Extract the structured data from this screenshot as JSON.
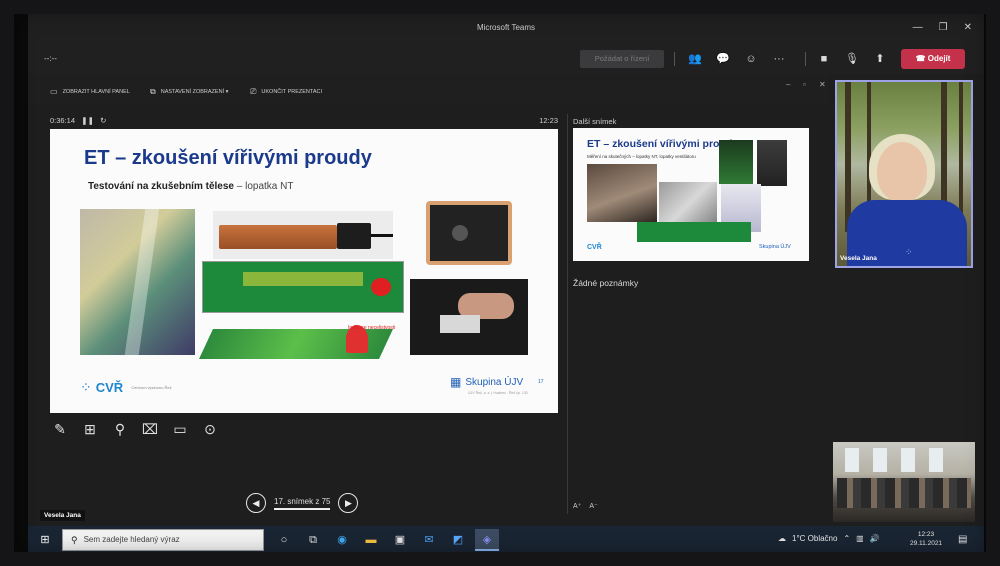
{
  "window": {
    "title": "Microsoft Teams",
    "controls": {
      "minimize": "—",
      "restore": "❐",
      "close": "✕"
    }
  },
  "meeting": {
    "timer": "--:--",
    "request_control_label": "Požádat o řízení",
    "icons": [
      "people-icon",
      "chat-icon",
      "reactions-icon",
      "more-icon",
      "camera-icon",
      "mic-icon",
      "share-icon"
    ],
    "leave_label": "Odejít",
    "leave_color": "#c4314b"
  },
  "presenter_bar": {
    "items": [
      {
        "label": "ZOBRAZIT HLAVNÍ PANEL",
        "icon": "taskbar-icon"
      },
      {
        "label": "NASTAVENÍ ZOBRAZENÍ ▾",
        "icon": "display-settings-icon"
      },
      {
        "label": "UKONČIT PREZENTACI",
        "icon": "end-presentation-icon"
      }
    ],
    "window_glyphs": [
      "–",
      "▫",
      "✕"
    ]
  },
  "presentation": {
    "elapsed": "0:36:14",
    "clock": "12:23",
    "slide": {
      "title": "ET – zkoušení vířivými proudy",
      "subtitle_bold": "Testování na zkušebním tělese",
      "subtitle_rest": " – lopatka NT",
      "annotation": "Indikace necelistvosti",
      "cvr_name": "CVŘ",
      "cvr_small": "Centrum výzkumu Řež",
      "ujv_name": "Skupina ÚJV",
      "ujv_small": "ÚJV Řež, a. s. | Husinec - Řež čp. 130",
      "number": "17"
    },
    "tools": [
      "pen-icon",
      "grid-icon",
      "zoom-icon",
      "pointer-screen-icon",
      "subtitles-icon",
      "more-options-icon"
    ],
    "nav": {
      "prev": "◀",
      "label": "17. snímek z 75",
      "next": "▶"
    }
  },
  "next_panel": {
    "label": "Další snímek",
    "thumb_title": "ET – zkoušení vířivými proudy",
    "thumb_sub": "Měření na skutečných – lopatky NT, lopatky ventilátoru",
    "thumb_cvr": "CVŘ",
    "thumb_ujv": "Skupina ÚJV",
    "notes": "Žádné poznámky",
    "font_ctrls": [
      "A⁺",
      "A⁻"
    ]
  },
  "participants": {
    "main_name": "Vesela Jana",
    "caption_name": "Vesela Jana"
  },
  "taskbar": {
    "search_placeholder": "Sem zadejte hledaný výraz",
    "apps": [
      "task-view-icon",
      "edge-icon",
      "explorer-icon",
      "store-icon",
      "mail-icon",
      "photoshop-icon",
      "teams-icon"
    ],
    "weather": "1°C  Oblačno",
    "time": "12:23",
    "date": "29.11.2021"
  }
}
